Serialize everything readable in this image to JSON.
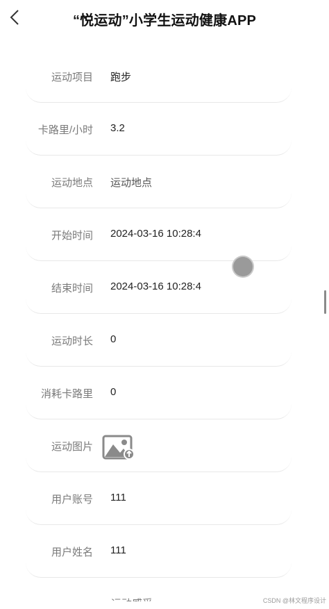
{
  "header": {
    "title": "“悦运动”小学生运动健康APP",
    "back_icon": "chevron-left-icon"
  },
  "form": {
    "rows": [
      {
        "label": "运动项目",
        "value": "跑步"
      },
      {
        "label": "卡路里/小时",
        "value": "3.2"
      },
      {
        "label": "运动地点",
        "value": "运动地点"
      },
      {
        "label": "开始时间",
        "value": "2024-03-16 10:28:4"
      },
      {
        "label": "结束时间",
        "value": "2024-03-16 10:28:4"
      },
      {
        "label": "运动时长",
        "value": "0"
      },
      {
        "label": "消耗卡路里",
        "value": "0"
      },
      {
        "label": "运动图片",
        "value": "",
        "icon": "image-upload-icon"
      },
      {
        "label": "用户账号",
        "value": "111"
      },
      {
        "label": "用户姓名",
        "value": "111"
      }
    ],
    "partial_label": "运动感受"
  },
  "watermark": "CSDN @林文程序设计"
}
